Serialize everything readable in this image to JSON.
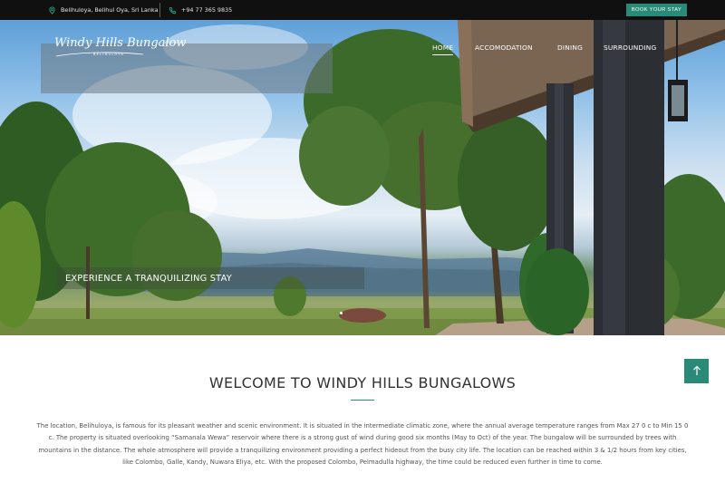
{
  "topbar": {
    "location": "Belihuloya, Belihul Oya, Sri Lanka",
    "phone": "+94 77 365 9835",
    "book_label": "BOOK YOUR STAY"
  },
  "header": {
    "logo_text": "Windy Hills Bungalow",
    "logo_subtext": "BELIHULOYA"
  },
  "nav": {
    "items": [
      {
        "label": "HOME"
      },
      {
        "label": "ACCOMODATION"
      },
      {
        "label": "DINING"
      },
      {
        "label": "SURROUNDING"
      }
    ]
  },
  "hero": {
    "tagline": "EXPERIENCE A TRANQUILIZING STAY"
  },
  "main": {
    "title": "WELCOME TO WINDY HILLS BUNGALOWS",
    "paragraph": "The location, Belihuloya, is famous for its pleasant weather and scenic environment. It is situated in the intermediate climatic zone, where the annual average temperature ranges from Max 27 0 c to Min 15 0 c. The property is situated overlooking “Samanala Wewa” reservoir where there is a strong gust of wind during good six months (May to Oct) of the year. The bungalow will be surrounded by trees with mountains in the distance. The whole atmosphere will provide a tranquilizing environment providing a perfect hideout from the busy city life. The location can be reached within 3 & 1/2 hours from key cities, like Colombo, Galle, Kandy, Nuwara Eliya, etc. With the proposed Colombo, Pelmadulla highway, the time could be reduced even further in time to come."
  },
  "icons": {
    "location": "map-pin-icon",
    "phone": "phone-icon",
    "scroll_top": "arrow-up-icon"
  },
  "colors": {
    "accent": "#2a8a78",
    "topbar": "#101010",
    "heading": "#333333",
    "body_text": "#555555"
  }
}
